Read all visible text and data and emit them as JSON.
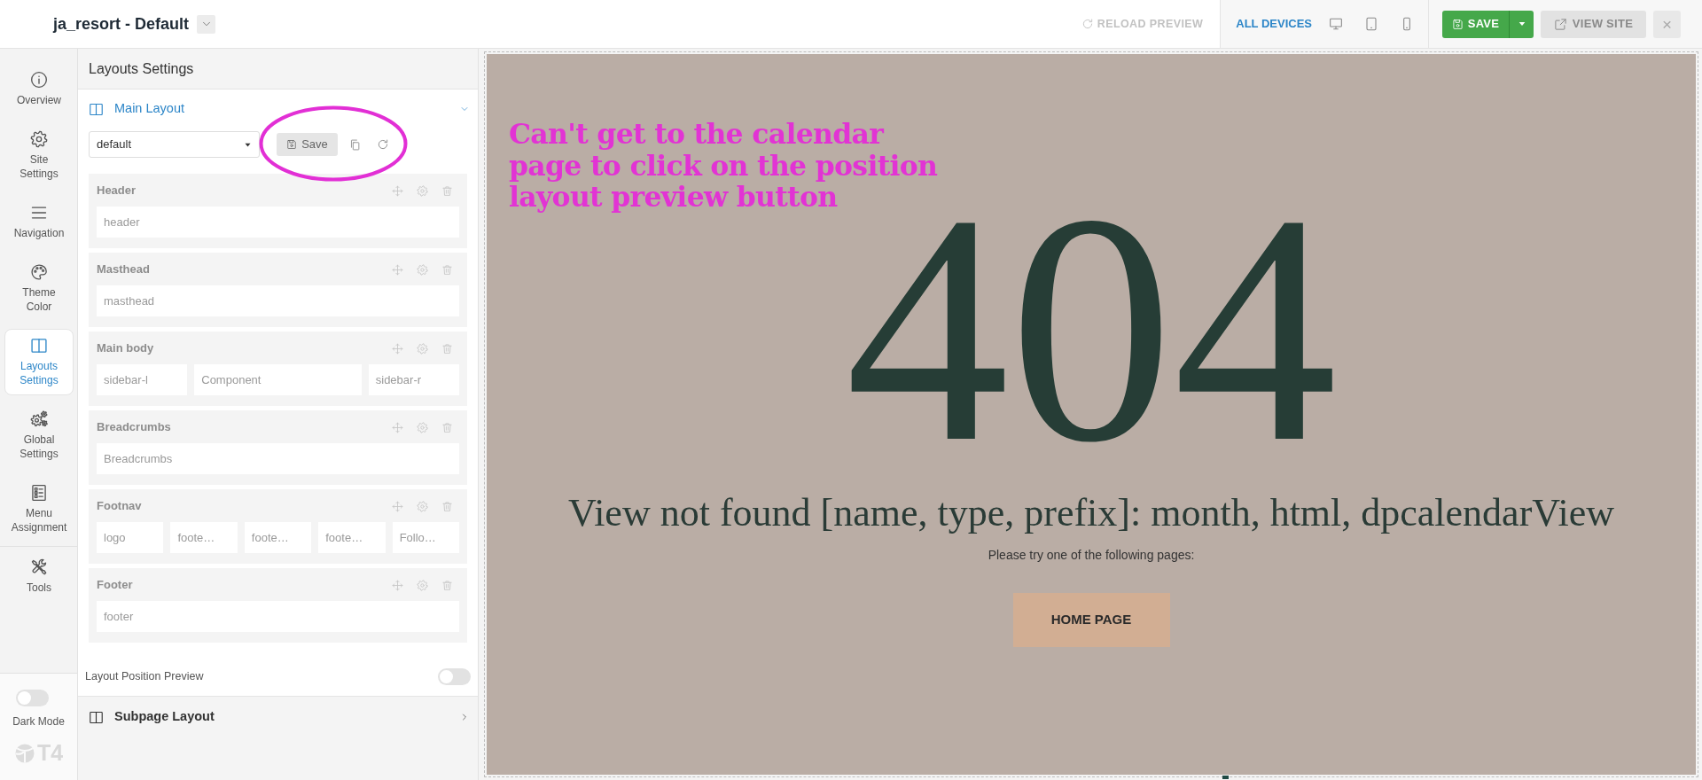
{
  "header": {
    "title": "ja_resort - Default",
    "reload_label": "RELOAD PREVIEW",
    "device_mode": {
      "label": "ALL DEVICES",
      "selected": true
    },
    "devices": [
      {
        "kind": "desktop",
        "selected": false
      },
      {
        "kind": "tablet",
        "selected": false
      },
      {
        "kind": "mobile",
        "selected": false
      }
    ],
    "save_label": "SAVE",
    "view_site_label": "VIEW SITE",
    "close_label": "×"
  },
  "rail": {
    "groups": [
      {
        "items": [
          {
            "kind": "info",
            "label": "Overview",
            "selected": false
          },
          {
            "kind": "gear",
            "label": "Site Settings",
            "selected": false
          },
          {
            "kind": "menu",
            "label": "Navigation",
            "selected": false
          },
          {
            "kind": "palette",
            "label": "Theme Color",
            "selected": false
          },
          {
            "kind": "layout",
            "label": "Layouts Settings",
            "selected": true
          },
          {
            "kind": "gears",
            "label": "Global Settings",
            "selected": false
          },
          {
            "kind": "checklist",
            "label": "Menu Assignment",
            "selected": false
          }
        ]
      },
      {
        "items": [
          {
            "kind": "tools",
            "label": "Tools",
            "selected": false
          }
        ]
      }
    ],
    "dark_mode": {
      "label": "Dark Mode",
      "on": false
    },
    "brand_text": "T4"
  },
  "panel": {
    "title": "Layouts Settings",
    "main_layout": {
      "title": "Main Layout",
      "expanded": true,
      "select_value": "default",
      "save_label": "Save",
      "sections": [
        {
          "title": "Header",
          "positions": [
            "header"
          ]
        },
        {
          "title": "Masthead",
          "positions": [
            "masthead"
          ]
        },
        {
          "title": "Main body",
          "positions": [
            "sidebar-l",
            "Component",
            "sidebar-r"
          ]
        },
        {
          "title": "Breadcrumbs",
          "positions": [
            "Breadcrumbs"
          ]
        },
        {
          "title": "Footnav",
          "positions": [
            "logo",
            "foote…",
            "foote…",
            "foote…",
            "Follo…"
          ]
        },
        {
          "title": "Footer",
          "positions": [
            "footer"
          ]
        }
      ]
    },
    "position_preview": {
      "label": "Layout Position Preview",
      "on": false
    },
    "subpage_layout": {
      "title": "Subpage Layout",
      "expanded": false
    }
  },
  "preview": {
    "annotation": {
      "lines": [
        "Can't get to the calendar",
        "page to click on the position",
        "layout preview button"
      ]
    },
    "error_code": "404",
    "message": "View not found [name, type, prefix]: month, html, dpcalendarView",
    "hint": "Please try one of the following pages:",
    "home_button": "HOME PAGE"
  }
}
